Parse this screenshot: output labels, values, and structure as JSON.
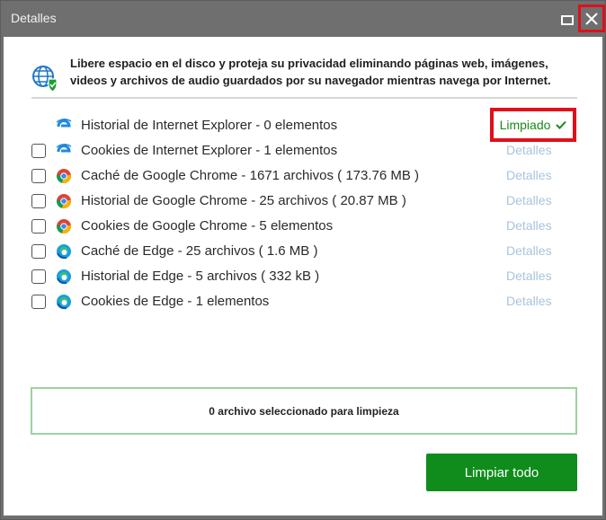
{
  "window": {
    "title": "Detalles"
  },
  "intro": {
    "text": "Libere espacio en el disco y proteja su privacidad eliminando páginas web, imágenes, videos y archivos de audio guardados por su navegador mientras navega por Internet."
  },
  "items": [
    {
      "label": "Historial de Internet Explorer - 0 elementos",
      "browser": "internet-explorer",
      "status": "Limpiado",
      "has_checkbox": false
    },
    {
      "label": "Cookies de Internet Explorer - 1 elementos",
      "browser": "internet-explorer",
      "details": "Detalles",
      "checked": false
    },
    {
      "label": "Caché de Google Chrome - 1671 archivos ( 173.76 MB )",
      "browser": "chrome",
      "details": "Detalles",
      "checked": false
    },
    {
      "label": "Historial de Google Chrome - 25 archivos ( 20.87 MB )",
      "browser": "chrome",
      "details": "Detalles",
      "checked": false
    },
    {
      "label": "Cookies de Google Chrome - 5 elementos",
      "browser": "chrome",
      "details": "Detalles",
      "checked": false
    },
    {
      "label": "Caché de Edge - 25 archivos ( 1.6 MB )",
      "browser": "edge",
      "details": "Detalles",
      "checked": false
    },
    {
      "label": "Historial de Edge - 5 archivos ( 332 kB )",
      "browser": "edge",
      "details": "Detalles",
      "checked": false
    },
    {
      "label": "Cookies de Edge - 1 elementos",
      "browser": "edge",
      "details": "Detalles",
      "checked": false
    }
  ],
  "summary": {
    "text": "0 archivo seleccionado para limpieza"
  },
  "actions": {
    "clean_all_label": "Limpiar todo"
  },
  "colors": {
    "accent_green": "#0f8c1c",
    "status_green": "#1a8a1a",
    "highlight_red": "#e0101a",
    "details_link": "#a8c4dc"
  }
}
